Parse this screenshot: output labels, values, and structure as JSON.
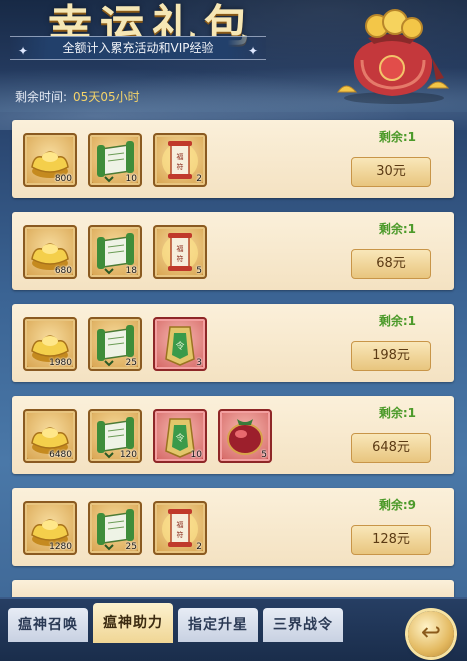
{
  "header": {
    "title": "幸运礼包",
    "subtitle": "全额计入累充活动和VIP经验",
    "remaining_label": "剩余时间:",
    "remaining_value": "05天05小时"
  },
  "packs": [
    {
      "left": "剩余:1",
      "price": "30元",
      "items": [
        {
          "icon": "gold-ingot-icon",
          "qty": "800",
          "frame": "gold"
        },
        {
          "icon": "green-scroll-icon",
          "qty": "10",
          "frame": "gold"
        },
        {
          "icon": "fortune-scroll-icon",
          "qty": "2",
          "frame": "gold"
        }
      ]
    },
    {
      "left": "剩余:1",
      "price": "68元",
      "items": [
        {
          "icon": "gold-ingot-icon",
          "qty": "680",
          "frame": "gold"
        },
        {
          "icon": "green-scroll-icon",
          "qty": "18",
          "frame": "gold"
        },
        {
          "icon": "fortune-scroll-icon",
          "qty": "5",
          "frame": "gold"
        }
      ]
    },
    {
      "left": "剩余:1",
      "price": "198元",
      "items": [
        {
          "icon": "gold-ingot-icon",
          "qty": "1980",
          "frame": "gold"
        },
        {
          "icon": "green-scroll-icon",
          "qty": "25",
          "frame": "gold"
        },
        {
          "icon": "jade-token-icon",
          "qty": "3",
          "frame": "red"
        }
      ]
    },
    {
      "left": "剩余:1",
      "price": "648元",
      "items": [
        {
          "icon": "gold-ingot-icon",
          "qty": "6480",
          "frame": "gold"
        },
        {
          "icon": "green-scroll-icon",
          "qty": "120",
          "frame": "gold"
        },
        {
          "icon": "jade-token-icon",
          "qty": "10",
          "frame": "red"
        },
        {
          "icon": "red-gem-icon",
          "qty": "5",
          "frame": "red"
        }
      ]
    },
    {
      "left": "剩余:9",
      "price": "128元",
      "items": [
        {
          "icon": "gold-ingot-icon",
          "qty": "1280",
          "frame": "gold"
        },
        {
          "icon": "green-scroll-icon",
          "qty": "25",
          "frame": "gold"
        },
        {
          "icon": "fortune-scroll-icon",
          "qty": "2",
          "frame": "gold"
        }
      ]
    }
  ],
  "tabs": [
    "瘟神召唤",
    "瘟神助力",
    "指定升星",
    "三界战令"
  ],
  "active_tab": 1,
  "back_icon": "return-arrow-icon"
}
